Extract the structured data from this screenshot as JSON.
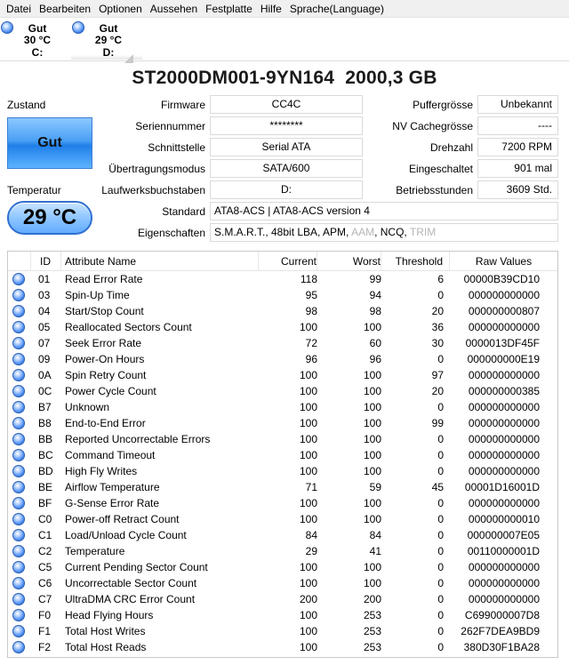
{
  "menu": [
    "Datei",
    "Bearbeiten",
    "Optionen",
    "Aussehen",
    "Festplatte",
    "Hilfe",
    "Sprache(Language)"
  ],
  "disks": [
    {
      "status": "Gut",
      "temp": "30 °C",
      "drive": "C:"
    },
    {
      "status": "Gut",
      "temp": "29 °C",
      "drive": "D:"
    }
  ],
  "title": "ST2000DM001-9YN164  2000,3 GB",
  "status": {
    "label": "Zustand",
    "value": "Gut",
    "color": "#4aa0f5"
  },
  "temperature": {
    "label": "Temperatur",
    "value": "29 °C"
  },
  "info": {
    "firmware_label": "Firmware",
    "firmware": "CC4C",
    "serial_label": "Seriennummer",
    "serial": "********",
    "interface_label": "Schnittstelle",
    "interface": "Serial ATA",
    "transfer_label": "Übertragungsmodus",
    "transfer": "SATA/600",
    "letters_label": "Laufwerksbuchstaben",
    "letters": "D:",
    "standard_label": "Standard",
    "standard": "ATA8-ACS | ATA8-ACS version 4",
    "features_label": "Eigenschaften",
    "features_active": "S.M.A.R.T., 48bit LBA, APM, ",
    "features_aam": "AAM",
    "features_ncq": ", NCQ, ",
    "features_trim": "TRIM",
    "buffer_label": "Puffergrösse",
    "buffer": "Unbekannt",
    "nvcache_label": "NV Cachegrösse",
    "nvcache": "----",
    "rpm_label": "Drehzahl",
    "rpm": "7200 RPM",
    "power_on_count_label": "Eingeschaltet",
    "power_on_count": "901 mal",
    "hours_label": "Betriebsstunden",
    "hours": "3609 Std."
  },
  "table": {
    "headers": {
      "id": "ID",
      "name": "Attribute Name",
      "current": "Current",
      "worst": "Worst",
      "threshold": "Threshold",
      "raw": "Raw Values"
    },
    "rows": [
      {
        "id": "01",
        "name": "Read Error Rate",
        "current": "118",
        "worst": "99",
        "threshold": "6",
        "raw": "00000B39CD10"
      },
      {
        "id": "03",
        "name": "Spin-Up Time",
        "current": "95",
        "worst": "94",
        "threshold": "0",
        "raw": "000000000000"
      },
      {
        "id": "04",
        "name": "Start/Stop Count",
        "current": "98",
        "worst": "98",
        "threshold": "20",
        "raw": "000000000807"
      },
      {
        "id": "05",
        "name": "Reallocated Sectors Count",
        "current": "100",
        "worst": "100",
        "threshold": "36",
        "raw": "000000000000"
      },
      {
        "id": "07",
        "name": "Seek Error Rate",
        "current": "72",
        "worst": "60",
        "threshold": "30",
        "raw": "0000013DF45F"
      },
      {
        "id": "09",
        "name": "Power-On Hours",
        "current": "96",
        "worst": "96",
        "threshold": "0",
        "raw": "000000000E19"
      },
      {
        "id": "0A",
        "name": "Spin Retry Count",
        "current": "100",
        "worst": "100",
        "threshold": "97",
        "raw": "000000000000"
      },
      {
        "id": "0C",
        "name": "Power Cycle Count",
        "current": "100",
        "worst": "100",
        "threshold": "20",
        "raw": "000000000385"
      },
      {
        "id": "B7",
        "name": "Unknown",
        "current": "100",
        "worst": "100",
        "threshold": "0",
        "raw": "000000000000"
      },
      {
        "id": "B8",
        "name": "End-to-End Error",
        "current": "100",
        "worst": "100",
        "threshold": "99",
        "raw": "000000000000"
      },
      {
        "id": "BB",
        "name": "Reported Uncorrectable Errors",
        "current": "100",
        "worst": "100",
        "threshold": "0",
        "raw": "000000000000"
      },
      {
        "id": "BC",
        "name": "Command Timeout",
        "current": "100",
        "worst": "100",
        "threshold": "0",
        "raw": "000000000000"
      },
      {
        "id": "BD",
        "name": "High Fly Writes",
        "current": "100",
        "worst": "100",
        "threshold": "0",
        "raw": "000000000000"
      },
      {
        "id": "BE",
        "name": "Airflow Temperature",
        "current": "71",
        "worst": "59",
        "threshold": "45",
        "raw": "00001D16001D"
      },
      {
        "id": "BF",
        "name": "G-Sense Error Rate",
        "current": "100",
        "worst": "100",
        "threshold": "0",
        "raw": "000000000000"
      },
      {
        "id": "C0",
        "name": "Power-off Retract Count",
        "current": "100",
        "worst": "100",
        "threshold": "0",
        "raw": "000000000010"
      },
      {
        "id": "C1",
        "name": "Load/Unload Cycle Count",
        "current": "84",
        "worst": "84",
        "threshold": "0",
        "raw": "000000007E05"
      },
      {
        "id": "C2",
        "name": "Temperature",
        "current": "29",
        "worst": "41",
        "threshold": "0",
        "raw": "00110000001D"
      },
      {
        "id": "C5",
        "name": "Current Pending Sector Count",
        "current": "100",
        "worst": "100",
        "threshold": "0",
        "raw": "000000000000"
      },
      {
        "id": "C6",
        "name": "Uncorrectable Sector Count",
        "current": "100",
        "worst": "100",
        "threshold": "0",
        "raw": "000000000000"
      },
      {
        "id": "C7",
        "name": "UltraDMA CRC Error Count",
        "current": "200",
        "worst": "200",
        "threshold": "0",
        "raw": "000000000000"
      },
      {
        "id": "F0",
        "name": "Head Flying Hours",
        "current": "100",
        "worst": "253",
        "threshold": "0",
        "raw": "C699000007D8"
      },
      {
        "id": "F1",
        "name": "Total Host Writes",
        "current": "100",
        "worst": "253",
        "threshold": "0",
        "raw": "262F7DEA9BD9"
      },
      {
        "id": "F2",
        "name": "Total Host Reads",
        "current": "100",
        "worst": "253",
        "threshold": "0",
        "raw": "380D30F1BA28"
      }
    ]
  }
}
